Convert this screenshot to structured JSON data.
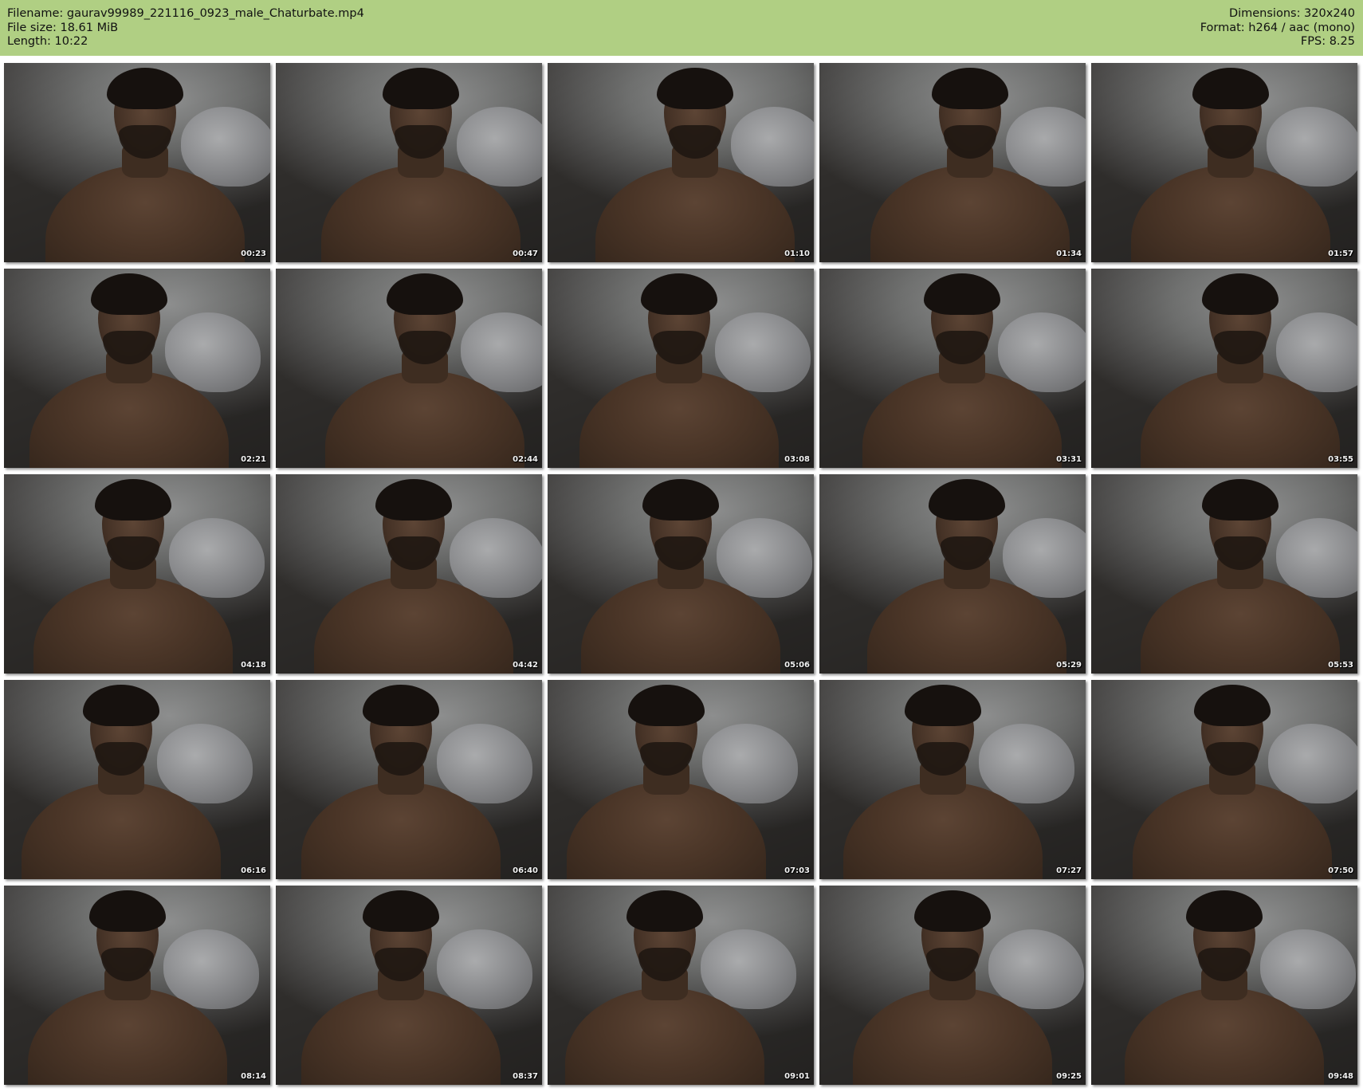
{
  "header": {
    "filename": "Filename: gaurav99989_221116_0923_male_Chaturbate.mp4",
    "file_size": "File size: 18.61 MiB",
    "length": "Length: 10:22",
    "dimensions": "Dimensions: 320x240",
    "format": "Format: h264 / aac (mono)",
    "fps": "FPS: 8.25"
  },
  "thumbnails": [
    "00:23",
    "00:47",
    "01:10",
    "01:34",
    "01:57",
    "02:21",
    "02:44",
    "03:08",
    "03:31",
    "03:55",
    "04:18",
    "04:42",
    "05:06",
    "05:29",
    "05:53",
    "06:16",
    "06:40",
    "07:03",
    "07:27",
    "07:50",
    "08:14",
    "08:37",
    "09:01",
    "09:25",
    "09:48"
  ],
  "colors": {
    "header_bg": "#b0cf83",
    "page_bg": "#ffffff",
    "timestamp": "#f2f2f2"
  }
}
